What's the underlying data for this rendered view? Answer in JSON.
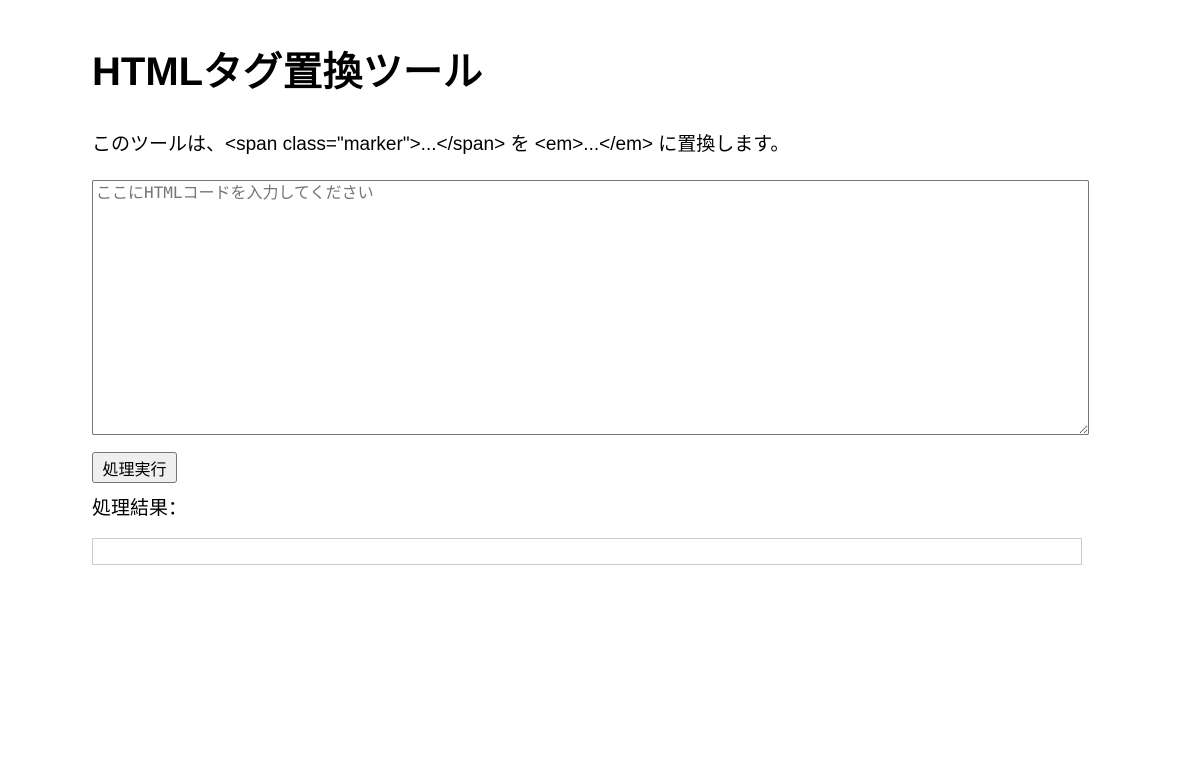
{
  "page": {
    "title": "HTMLタグ置換ツール",
    "description": "このツールは、<span class=\"marker\">...</span> を <em>...</em> に置換します。"
  },
  "form": {
    "input_placeholder": "ここにHTMLコードを入力してください",
    "input_value": "",
    "run_button_label": "処理実行"
  },
  "result": {
    "label": "処理結果：",
    "output": ""
  }
}
